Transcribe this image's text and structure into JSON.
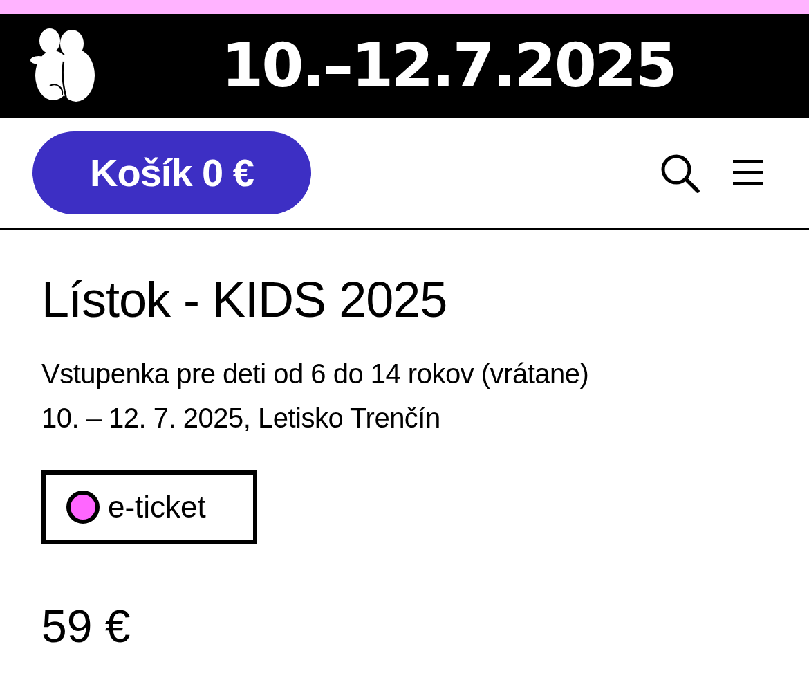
{
  "banner": {
    "dates": "10.–12.7.2025"
  },
  "header": {
    "cart_button": "Košík 0 €"
  },
  "product": {
    "title": "Lístok - KIDS 2025",
    "description": [
      "Vstupenka pre deti od 6 do 14 rokov (vrátane)",
      "10. – 12. 7. 2025, Letisko Trenčín"
    ],
    "tags": [
      {
        "label": "e-ticket",
        "color": "#ff66ff"
      }
    ],
    "price": "59 €"
  }
}
